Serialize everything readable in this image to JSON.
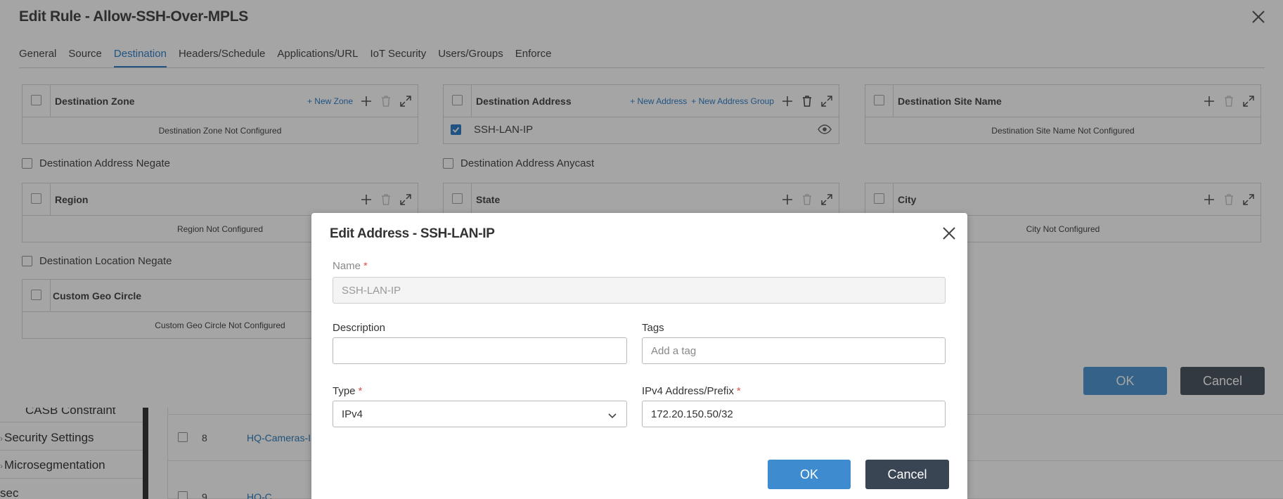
{
  "rule_modal": {
    "title": "Edit Rule - Allow-SSH-Over-MPLS",
    "tabs": [
      "General",
      "Source",
      "Destination",
      "Headers/Schedule",
      "Applications/URL",
      "IoT Security",
      "Users/Groups",
      "Enforce"
    ],
    "active_tab": "Destination",
    "panels": {
      "destination_zone": {
        "title": "Destination Zone",
        "link": "+ New Zone",
        "empty": "Destination Zone Not Configured"
      },
      "destination_address": {
        "title": "Destination Address",
        "link1": "+ New Address",
        "link2": "+ New Address Group",
        "row_value": "SSH-LAN-IP",
        "row_checked": true
      },
      "destination_site_name": {
        "title": "Destination Site Name",
        "empty": "Destination Site Name Not Configured"
      },
      "region": {
        "title": "Region",
        "empty": "Region Not Configured"
      },
      "state": {
        "title": "State"
      },
      "city": {
        "title": "City",
        "empty": "City Not Configured"
      },
      "custom_geo_circle": {
        "title": "Custom Geo Circle",
        "empty": "Custom Geo Circle Not Configured"
      }
    },
    "checkboxes": {
      "address_negate": "Destination Address Negate",
      "address_anycast": "Destination Address Anycast",
      "location_negate": "Destination Location Negate"
    },
    "ok_label": "OK",
    "cancel_label": "Cancel"
  },
  "background": {
    "sidebar_items": [
      {
        "label": "CASB Constraint",
        "arrow": false
      },
      {
        "label": "Security Settings",
        "arrow": true
      },
      {
        "label": "Microsegmentation",
        "arrow": true
      },
      {
        "label": "sec",
        "arrow": false
      }
    ],
    "rows": [
      {
        "num": "8",
        "name": "HQ-Cameras-In"
      },
      {
        "num": "9",
        "name": "HQ-C"
      }
    ]
  },
  "address_modal": {
    "title": "Edit Address - SSH-LAN-IP",
    "name_label": "Name",
    "name_value": "SSH-LAN-IP",
    "description_label": "Description",
    "description_value": "",
    "tags_label": "Tags",
    "tags_placeholder": "Add a tag",
    "type_label": "Type",
    "type_value": "IPv4",
    "ipv4_label": "IPv4 Address/Prefix",
    "ipv4_value": "172.20.150.50/32",
    "required_mark": "*",
    "ok_label": "OK",
    "cancel_label": "Cancel"
  },
  "colors": {
    "accent": "#1a73c5",
    "primary_button": "#3e8ccf",
    "secondary_button": "#3a4554",
    "required": "#d9534f"
  }
}
